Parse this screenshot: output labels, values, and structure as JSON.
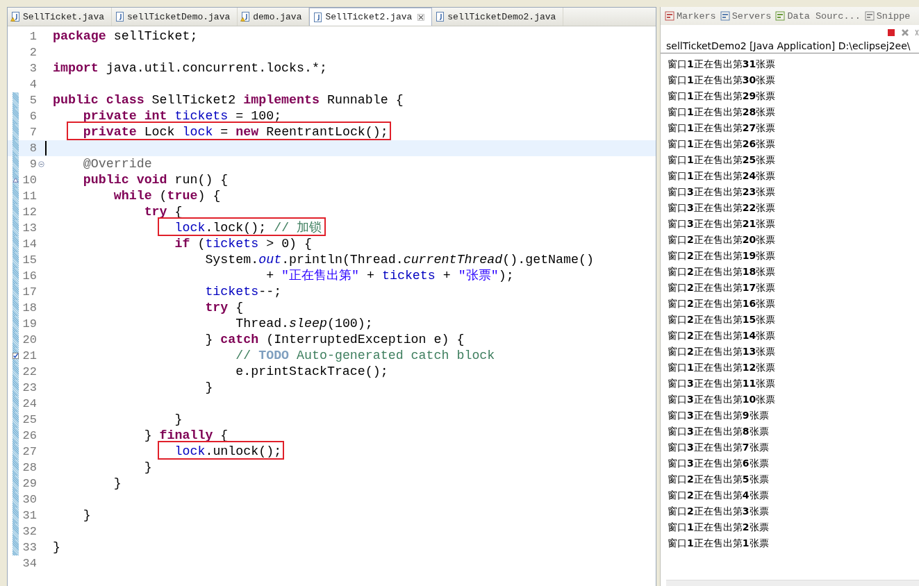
{
  "editor": {
    "tabs": [
      {
        "label": "SellTicket.java",
        "selected": false,
        "warning": true
      },
      {
        "label": "sellTicketDemo.java",
        "selected": false,
        "warning": false
      },
      {
        "label": "demo.java",
        "selected": false,
        "warning": true
      },
      {
        "label": "SellTicket2.java",
        "selected": true,
        "warning": false
      },
      {
        "label": "sellTicketDemo2.java",
        "selected": false,
        "warning": false
      }
    ],
    "lines": [
      {
        "n": "1",
        "kind": "plain",
        "changed": false,
        "current": false,
        "boxed": false,
        "tokens": [
          {
            "kind": "kw",
            "text": "package"
          },
          {
            "kind": "plain",
            "text": " sellTicket;"
          }
        ]
      },
      {
        "n": "2",
        "kind": "plain",
        "changed": false,
        "current": false,
        "boxed": false
      },
      {
        "n": "3",
        "kind": "plain",
        "changed": false,
        "current": false,
        "boxed": false,
        "tokens": [
          {
            "kind": "kw",
            "text": "import"
          },
          {
            "kind": "plain",
            "text": " java.util.concurrent.locks.*;"
          }
        ]
      },
      {
        "n": "4",
        "kind": "plain",
        "changed": false,
        "current": false,
        "boxed": false
      },
      {
        "n": "5",
        "kind": "plain",
        "changed": true,
        "current": false,
        "boxed": false,
        "tokens": [
          {
            "kind": "kw",
            "text": "public class"
          },
          {
            "kind": "plain",
            "text": " SellTicket2 "
          },
          {
            "kind": "kw",
            "text": "implements"
          },
          {
            "kind": "plain",
            "text": " Runnable {"
          }
        ]
      },
      {
        "n": "6",
        "kind": "plain",
        "changed": true,
        "current": false,
        "boxed": false,
        "tokens": [
          {
            "kind": "kw",
            "text": "    private int "
          },
          {
            "kind": "field",
            "text": "tickets"
          },
          {
            "kind": "plain",
            "text": " = 100;"
          }
        ]
      },
      {
        "n": "7",
        "kind": "plain",
        "changed": true,
        "current": false,
        "boxed": true,
        "tokens": [
          {
            "kind": "kw",
            "text": "    private"
          },
          {
            "kind": "plain",
            "text": " Lock "
          },
          {
            "kind": "field",
            "text": "lock"
          },
          {
            "kind": "plain",
            "text": " = "
          },
          {
            "kind": "kw",
            "text": "new"
          },
          {
            "kind": "plain",
            "text": " ReentrantLock();"
          }
        ]
      },
      {
        "n": "8",
        "kind": "plain",
        "changed": true,
        "current": true,
        "boxed": false
      },
      {
        "n": "9",
        "kind": "fold",
        "changed": true,
        "current": false,
        "boxed": false,
        "tokens": [
          {
            "kind": "ann",
            "text": "    @Override"
          }
        ]
      },
      {
        "n": "10",
        "kind": "override",
        "changed": true,
        "current": false,
        "boxed": false,
        "tokens": [
          {
            "kind": "kw",
            "text": "    public void"
          },
          {
            "kind": "plain",
            "text": " run() {"
          }
        ]
      },
      {
        "n": "11",
        "kind": "plain",
        "changed": true,
        "current": false,
        "boxed": false,
        "tokens": [
          {
            "kind": "kw",
            "text": "        while"
          },
          {
            "kind": "plain",
            "text": " ("
          },
          {
            "kind": "kw",
            "text": "true"
          },
          {
            "kind": "plain",
            "text": ") {"
          }
        ]
      },
      {
        "n": "12",
        "kind": "plain",
        "changed": true,
        "current": false,
        "boxed": false,
        "tokens": [
          {
            "kind": "kw",
            "text": "            try"
          },
          {
            "kind": "plain",
            "text": " {"
          }
        ]
      },
      {
        "n": "13",
        "kind": "plain",
        "changed": true,
        "current": false,
        "boxed": true,
        "tokens": [
          {
            "kind": "field",
            "text": "                lock"
          },
          {
            "kind": "plain",
            "text": ".lock(); "
          },
          {
            "kind": "cmt",
            "text": "// 加锁"
          }
        ]
      },
      {
        "n": "14",
        "kind": "plain",
        "changed": true,
        "current": false,
        "boxed": false,
        "tokens": [
          {
            "kind": "kw",
            "text": "                if"
          },
          {
            "kind": "plain",
            "text": " ("
          },
          {
            "kind": "field",
            "text": "tickets"
          },
          {
            "kind": "plain",
            "text": " > 0) {"
          }
        ]
      },
      {
        "n": "15",
        "kind": "plain",
        "changed": true,
        "current": false,
        "boxed": false,
        "tokens": [
          {
            "kind": "plain",
            "text": "                    System."
          },
          {
            "kind": "static",
            "text": "out"
          },
          {
            "kind": "plain",
            "text": ".println(Thread."
          },
          {
            "kind": "italic",
            "text": "currentThread"
          },
          {
            "kind": "plain",
            "text": "().getName()"
          }
        ]
      },
      {
        "n": "16",
        "kind": "plain",
        "changed": true,
        "current": false,
        "boxed": false,
        "tokens": [
          {
            "kind": "plain",
            "text": "                            + "
          },
          {
            "kind": "str",
            "text": "\"正在售出第\""
          },
          {
            "kind": "plain",
            "text": " + "
          },
          {
            "kind": "field",
            "text": "tickets"
          },
          {
            "kind": "plain",
            "text": " + "
          },
          {
            "kind": "str",
            "text": "\"张票\""
          },
          {
            "kind": "plain",
            "text": ");"
          }
        ]
      },
      {
        "n": "17",
        "kind": "plain",
        "changed": true,
        "current": false,
        "boxed": false,
        "tokens": [
          {
            "kind": "field",
            "text": "                    tickets"
          },
          {
            "kind": "plain",
            "text": "--;"
          }
        ]
      },
      {
        "n": "18",
        "kind": "plain",
        "changed": true,
        "current": false,
        "boxed": false,
        "tokens": [
          {
            "kind": "kw",
            "text": "                    try"
          },
          {
            "kind": "plain",
            "text": " {"
          }
        ]
      },
      {
        "n": "19",
        "kind": "plain",
        "changed": true,
        "current": false,
        "boxed": false,
        "tokens": [
          {
            "kind": "plain",
            "text": "                        Thread."
          },
          {
            "kind": "italic",
            "text": "sleep"
          },
          {
            "kind": "plain",
            "text": "(100);"
          }
        ]
      },
      {
        "n": "20",
        "kind": "plain",
        "changed": true,
        "current": false,
        "boxed": false,
        "tokens": [
          {
            "kind": "plain",
            "text": "                    } "
          },
          {
            "kind": "kw",
            "text": "catch"
          },
          {
            "kind": "plain",
            "text": " (InterruptedException e) {"
          }
        ]
      },
      {
        "n": "21",
        "kind": "task",
        "changed": true,
        "current": false,
        "boxed": false,
        "tokens": [
          {
            "kind": "cmt",
            "text": "                        // "
          },
          {
            "kind": "todo",
            "text": "TODO"
          },
          {
            "kind": "cmt",
            "text": " Auto-generated catch block"
          }
        ]
      },
      {
        "n": "22",
        "kind": "plain",
        "changed": true,
        "current": false,
        "boxed": false,
        "tokens": [
          {
            "kind": "plain",
            "text": "                        e.printStackTrace();"
          }
        ]
      },
      {
        "n": "23",
        "kind": "plain",
        "changed": true,
        "current": false,
        "boxed": false,
        "tokens": [
          {
            "kind": "plain",
            "text": "                    }"
          }
        ]
      },
      {
        "n": "24",
        "kind": "plain",
        "changed": true,
        "current": false,
        "boxed": false
      },
      {
        "n": "25",
        "kind": "plain",
        "changed": true,
        "current": false,
        "boxed": false,
        "tokens": [
          {
            "kind": "plain",
            "text": "                }"
          }
        ]
      },
      {
        "n": "26",
        "kind": "plain",
        "changed": true,
        "current": false,
        "boxed": false,
        "tokens": [
          {
            "kind": "plain",
            "text": "            } "
          },
          {
            "kind": "kw",
            "text": "finally"
          },
          {
            "kind": "plain",
            "text": " {"
          }
        ]
      },
      {
        "n": "27",
        "kind": "plain",
        "changed": true,
        "current": false,
        "boxed": true,
        "tokens": [
          {
            "kind": "field",
            "text": "                lock"
          },
          {
            "kind": "plain",
            "text": ".unlock();"
          }
        ]
      },
      {
        "n": "28",
        "kind": "plain",
        "changed": true,
        "current": false,
        "boxed": false,
        "tokens": [
          {
            "kind": "plain",
            "text": "            }"
          }
        ]
      },
      {
        "n": "29",
        "kind": "plain",
        "changed": true,
        "current": false,
        "boxed": false,
        "tokens": [
          {
            "kind": "plain",
            "text": "        }"
          }
        ]
      },
      {
        "n": "30",
        "kind": "plain",
        "changed": true,
        "current": false,
        "boxed": false
      },
      {
        "n": "31",
        "kind": "plain",
        "changed": true,
        "current": false,
        "boxed": false,
        "tokens": [
          {
            "kind": "plain",
            "text": "    }"
          }
        ]
      },
      {
        "n": "32",
        "kind": "plain",
        "changed": true,
        "current": false,
        "boxed": false
      },
      {
        "n": "33",
        "kind": "plain",
        "changed": true,
        "current": false,
        "boxed": false,
        "tokens": [
          {
            "kind": "plain",
            "text": "}"
          }
        ]
      },
      {
        "n": "34",
        "kind": "plain",
        "changed": false,
        "current": false,
        "boxed": false
      }
    ]
  },
  "console": {
    "tabs": [
      {
        "label": "Markers"
      },
      {
        "label": "Servers"
      },
      {
        "label": "Data Sourc..."
      },
      {
        "label": "Snippe"
      }
    ],
    "title": "sellTicketDemo2 [Java Application] D:\\eclipsej2ee\\",
    "output": [
      "窗口**1**正在售出第**31**张票",
      "窗口**1**正在售出第**30**张票",
      "窗口**1**正在售出第**29**张票",
      "窗口**1**正在售出第**28**张票",
      "窗口**1**正在售出第**27**张票",
      "窗口**1**正在售出第**26**张票",
      "窗口**1**正在售出第**25**张票",
      "窗口**1**正在售出第**24**张票",
      "窗口**3**正在售出第**23**张票",
      "窗口**3**正在售出第**22**张票",
      "窗口**3**正在售出第**21**张票",
      "窗口**2**正在售出第**20**张票",
      "窗口**2**正在售出第**19**张票",
      "窗口**2**正在售出第**18**张票",
      "窗口**2**正在售出第**17**张票",
      "窗口**2**正在售出第**16**张票",
      "窗口**2**正在售出第**15**张票",
      "窗口**2**正在售出第**14**张票",
      "窗口**2**正在售出第**13**张票",
      "窗口**1**正在售出第**12**张票",
      "窗口**3**正在售出第**11**张票",
      "窗口**3**正在售出第**10**张票",
      "窗口**3**正在售出第**9**张票",
      "窗口**3**正在售出第**8**张票",
      "窗口**3**正在售出第**7**张票",
      "窗口**3**正在售出第**6**张票",
      "窗口**2**正在售出第**5**张票",
      "窗口**2**正在售出第**4**张票",
      "窗口**2**正在售出第**3**张票",
      "窗口**1**正在售出第**2**张票",
      "窗口**1**正在售出第**1**张票"
    ]
  }
}
